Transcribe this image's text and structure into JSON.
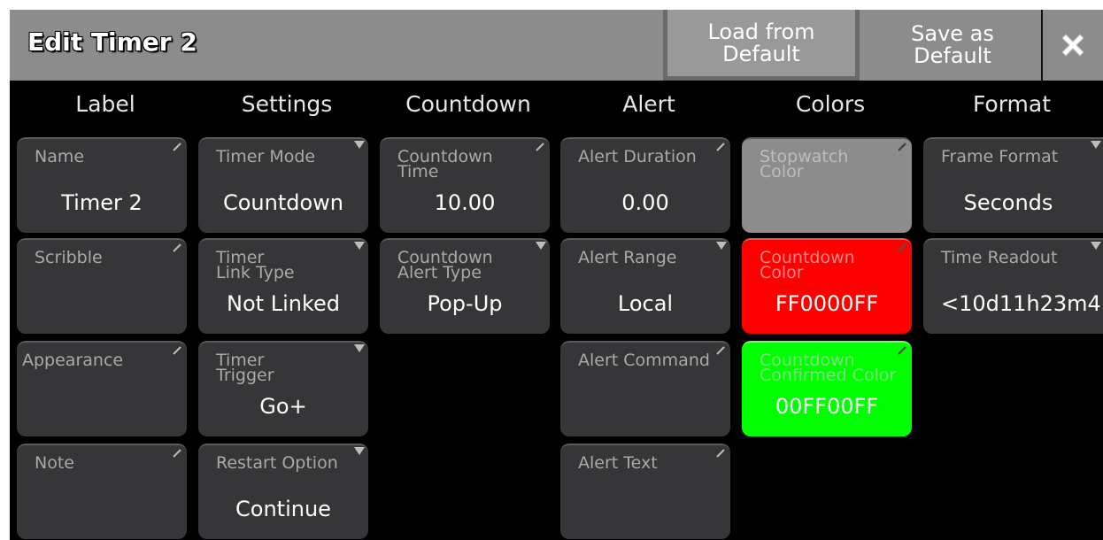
{
  "window": {
    "title": "Edit Timer 2",
    "load_button": "Load from\nDefault",
    "save_button": "Save as\nDefault",
    "close_icon": "close-x-icon"
  },
  "columns": [
    "Label",
    "Settings",
    "Countdown",
    "Alert",
    "Colors",
    "Format"
  ],
  "cells": {
    "name": {
      "label": "Name",
      "value": "Timer 2"
    },
    "scribble": {
      "label": "Scribble",
      "value": ""
    },
    "appearance": {
      "label": "Appearance",
      "value": ""
    },
    "note": {
      "label": "Note",
      "value": ""
    },
    "timer_mode": {
      "label": "Timer Mode",
      "value": "Countdown"
    },
    "timer_link_type": {
      "label": "Timer\nLink Type",
      "value": "Not Linked"
    },
    "timer_trigger": {
      "label": "Timer\nTrigger",
      "value": "Go+"
    },
    "restart_option": {
      "label": "Restart Option",
      "value": "Continue"
    },
    "countdown_time": {
      "label": "Countdown\nTime",
      "value": "10.00"
    },
    "countdown_alert_type": {
      "label": "Countdown\nAlert Type",
      "value": "Pop-Up"
    },
    "alert_duration": {
      "label": "Alert Duration",
      "value": "0.00"
    },
    "alert_range": {
      "label": "Alert Range",
      "value": "Local"
    },
    "alert_command": {
      "label": "Alert Command",
      "value": ""
    },
    "alert_text": {
      "label": "Alert Text",
      "value": ""
    },
    "stopwatch_color": {
      "label": "Stopwatch\nColor",
      "value": ""
    },
    "countdown_color": {
      "label": "Countdown\nColor",
      "value": "FF0000FF"
    },
    "countdown_confirmed_color": {
      "label": "Countdown\nConfirmed Color",
      "value": "00FF00FF"
    },
    "frame_format": {
      "label": "Frame Format",
      "value": "Seconds"
    },
    "time_readout": {
      "label": "Time Readout",
      "value": "<10d11h23m4"
    }
  },
  "colors": {
    "countdown": "#ff0000",
    "confirmed": "#00ff00",
    "stopwatch": "#8c8c8c"
  }
}
